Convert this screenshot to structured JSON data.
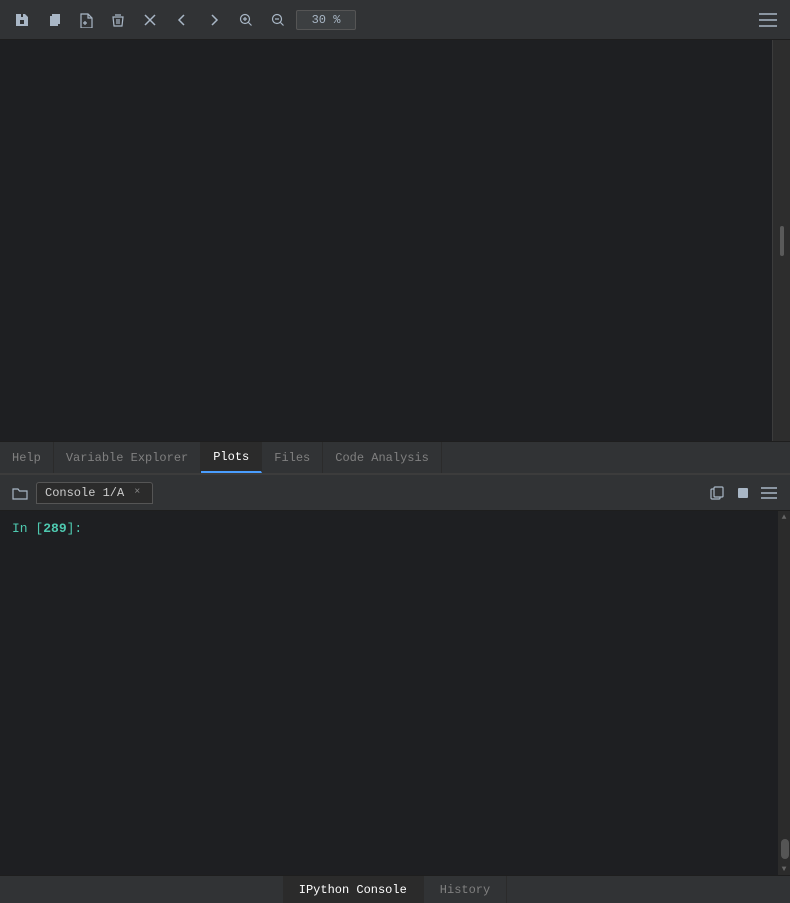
{
  "toolbar": {
    "buttons": [
      {
        "id": "save",
        "label": "Save",
        "icon": "save-icon"
      },
      {
        "id": "copy",
        "label": "Copy",
        "icon": "copy-icon"
      },
      {
        "id": "new",
        "label": "New",
        "icon": "new-icon"
      },
      {
        "id": "delete",
        "label": "Delete",
        "icon": "delete-icon"
      },
      {
        "id": "close-x",
        "label": "Close",
        "icon": "close-x-icon"
      },
      {
        "id": "back",
        "label": "Back",
        "icon": "back-icon"
      },
      {
        "id": "forward",
        "label": "Forward",
        "icon": "forward-icon"
      },
      {
        "id": "zoom-in",
        "label": "Zoom In",
        "icon": "zoom-in-icon"
      },
      {
        "id": "zoom-out",
        "label": "Zoom Out",
        "icon": "zoom-out-icon"
      }
    ],
    "zoom_value": "30 %",
    "menu_icon": "menu-icon"
  },
  "editor_tabs": [
    {
      "id": "help",
      "label": "Help",
      "active": false
    },
    {
      "id": "variable-explorer",
      "label": "Variable Explorer",
      "active": false
    },
    {
      "id": "plots",
      "label": "Plots",
      "active": true
    },
    {
      "id": "files",
      "label": "Files",
      "active": false
    },
    {
      "id": "code-analysis",
      "label": "Code Analysis",
      "active": false
    }
  ],
  "console": {
    "header": {
      "tab_label": "Console 1/A",
      "close_label": "×",
      "copy_label": "Copy",
      "stop_label": "Stop",
      "menu_label": "Menu"
    },
    "prompt": {
      "prefix": "In [",
      "number": "289",
      "suffix": "]:"
    },
    "bottom_tabs": [
      {
        "id": "ipython-console",
        "label": "IPython Console",
        "active": true
      },
      {
        "id": "history",
        "label": "History",
        "active": false
      }
    ]
  }
}
